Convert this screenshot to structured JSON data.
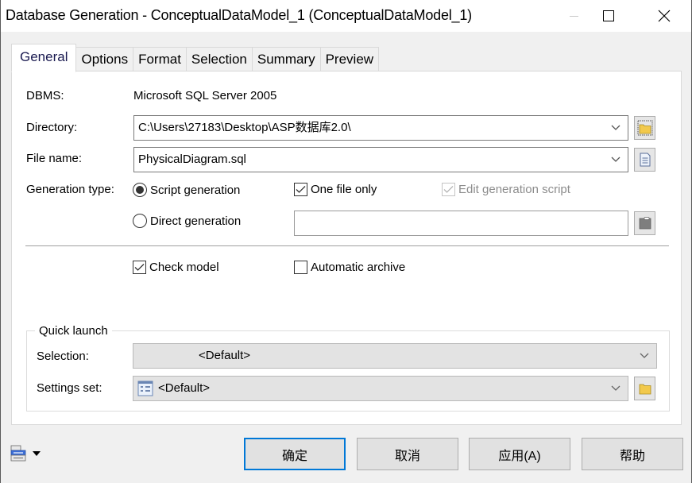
{
  "window": {
    "title": "Database Generation - ConceptualDataModel_1 (ConceptualDataModel_1)",
    "controls": {
      "minimize_enabled": false
    }
  },
  "tabs": [
    {
      "label": "General",
      "active": true
    },
    {
      "label": "Options",
      "active": false
    },
    {
      "label": "Format",
      "active": false
    },
    {
      "label": "Selection",
      "active": false
    },
    {
      "label": "Summary",
      "active": false
    },
    {
      "label": "Preview",
      "active": false
    }
  ],
  "general": {
    "dbms_label": "DBMS:",
    "dbms_value": "Microsoft SQL Server 2005",
    "directory_label": "Directory:",
    "directory_value": "C:\\Users\\27183\\Desktop\\ASP数据库2.0\\",
    "filename_label": "File name:",
    "filename_value": "PhysicalDiagram.sql",
    "generation_type_label": "Generation type:",
    "radio_script": {
      "label": "Script generation",
      "selected": true
    },
    "radio_direct": {
      "label": "Direct generation",
      "selected": false
    },
    "one_file_only": {
      "label": "One file only",
      "checked": true
    },
    "edit_generation_script": {
      "label": "Edit generation script",
      "checked": true,
      "enabled": false
    },
    "direct_input_value": "",
    "check_model": {
      "label": "Check model",
      "checked": true
    },
    "automatic_archive": {
      "label": "Automatic archive",
      "checked": false
    }
  },
  "quick_launch": {
    "title": "Quick launch",
    "selection_label": "Selection:",
    "selection_value": "<Default>",
    "settings_label": "Settings set:",
    "settings_value": "<Default>"
  },
  "buttons": {
    "ok": "确定",
    "cancel": "取消",
    "apply": "应用(A)",
    "help": "帮助"
  },
  "colors": {
    "accent": "#0078d7",
    "folder": "#f2c94c"
  }
}
